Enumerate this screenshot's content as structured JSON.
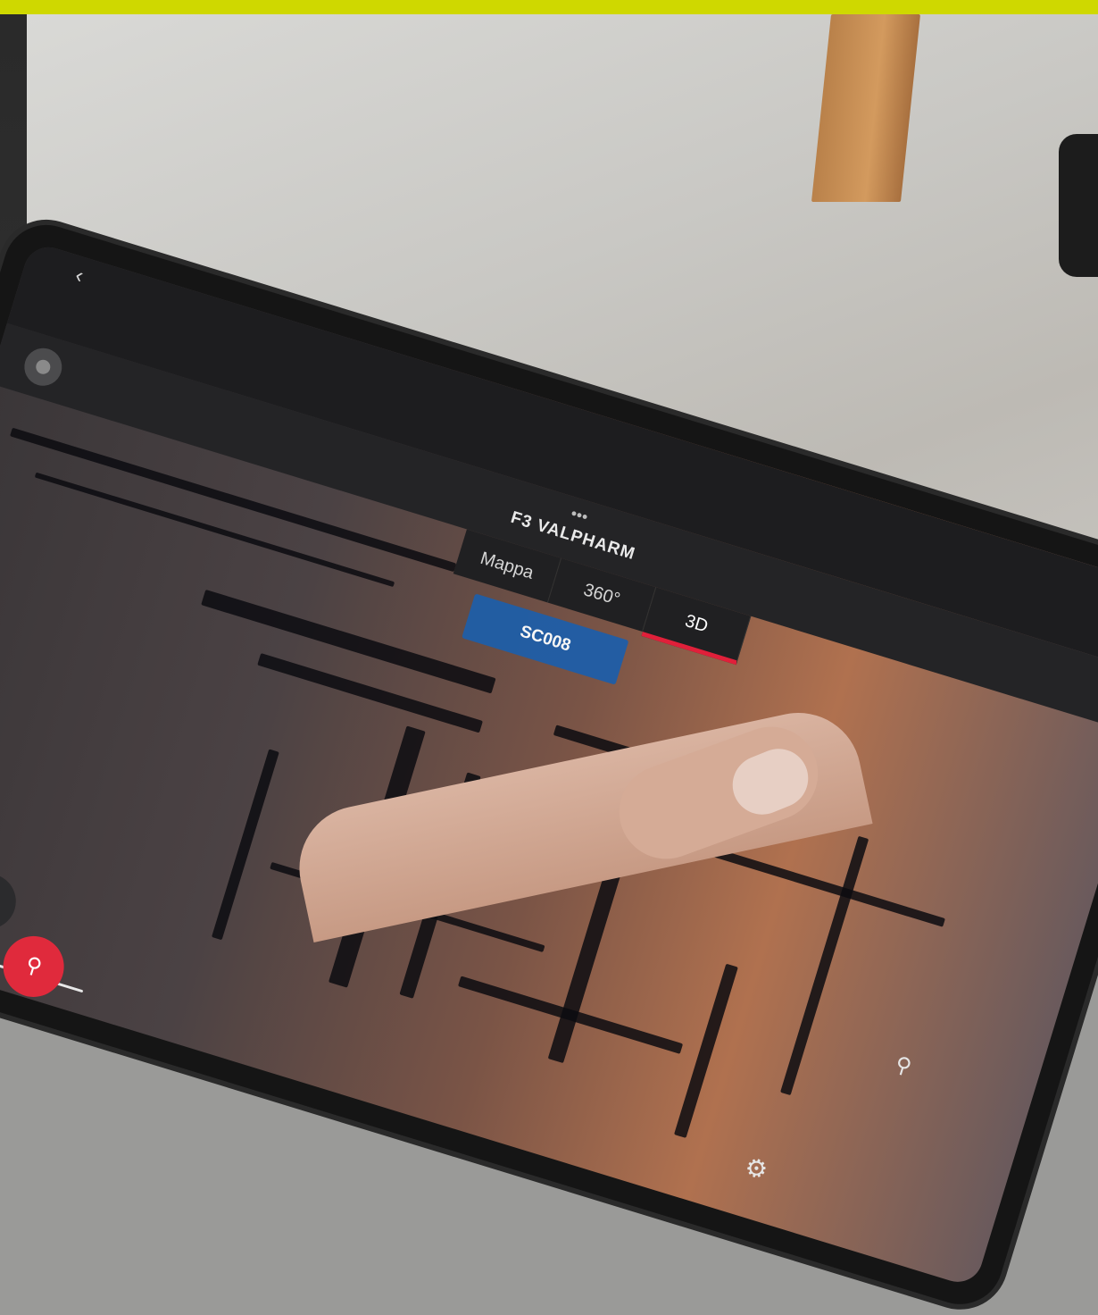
{
  "app": {
    "status_time": "",
    "project_title": "F3 VALPHARM",
    "more_glyph": "•••",
    "back_glyph": "‹"
  },
  "tabs": [
    {
      "label": "Mappa",
      "active": false
    },
    {
      "label": "360°",
      "active": false
    },
    {
      "label": "3D",
      "active": true
    }
  ],
  "scan_label": "SC008",
  "icons": {
    "record": "record-icon",
    "camera": "camera-rotate-icon",
    "pin": "pin-icon",
    "settings": "gear-icon",
    "right_pin": "pin-icon"
  },
  "glyphs": {
    "camera": "⟲",
    "pin": "⚲",
    "settings": "⚙",
    "right_pin": "⚲"
  },
  "colors": {
    "accent_yellow": "#cfd800",
    "active_tab_red": "#e0203a",
    "scan_label_blue": "#1f5ea8",
    "pin_button_red": "#e02a3c"
  }
}
